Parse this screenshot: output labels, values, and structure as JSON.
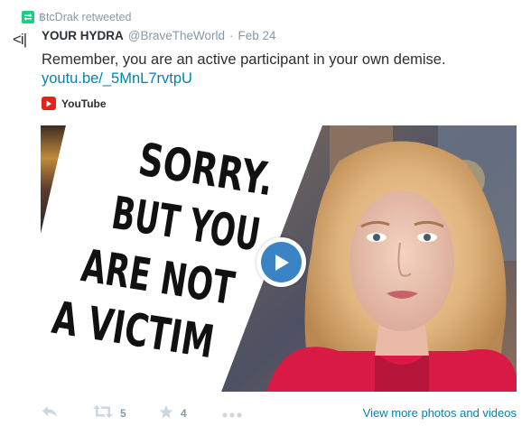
{
  "retweet_context": {
    "text": "฿tcDrak retweeted",
    "icon": "retweet-icon"
  },
  "avatar_stub": "<i|",
  "author": {
    "fullname": "YOUR HYDRA",
    "username": "@BraveTheWorld",
    "separator": "·",
    "timestamp": "Feb 24"
  },
  "tweet": {
    "text": "Remember, you are an active participant in your own demise.",
    "link": "youtu.be/_5MnL7rvtpU"
  },
  "card": {
    "source_label": "YouTube",
    "source_icon": "youtube-icon",
    "thumbnail_lines": [
      "SORRY.",
      "BUT YOU",
      "ARE NOT",
      "A VICTIM"
    ],
    "play_icon": "play-icon"
  },
  "actions": {
    "reply_icon": "reply-icon",
    "retweet_icon": "retweet-icon",
    "retweet_count": "5",
    "favorite_icon": "star-icon",
    "favorite_count": "4",
    "more_icon": "more-icon",
    "view_more": "View more photos and videos"
  },
  "colors": {
    "link": "#0084b4",
    "muted": "#8899a6",
    "retweet_green": "#19cf86",
    "youtube_red": "#e62117",
    "play_blue": "#3a84c6",
    "hoodie_red": "#d91a45"
  }
}
